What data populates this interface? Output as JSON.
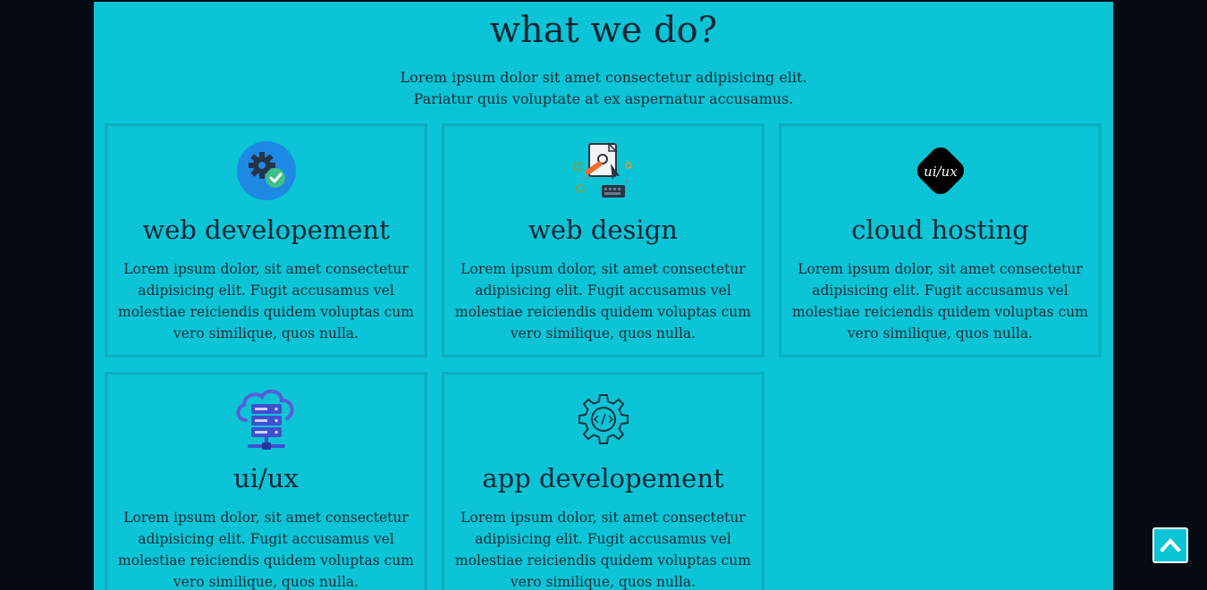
{
  "section": {
    "title": "what we do?",
    "subtitle_line1": "Lorem ipsum dolor sit amet consectetur adipisicing elit.",
    "subtitle_line2": "Pariatur quis voluptate at ex aspernatur accusamus."
  },
  "cards": [
    {
      "title": "web developement",
      "text": "Lorem ipsum dolor, sit amet consectetur adipisicing elit. Fugit accusamus vel molestiae reiciendis quidem voluptas cum vero similique, quos nulla.",
      "icon": "gear-check-icon"
    },
    {
      "title": "web design",
      "text": "Lorem ipsum dolor, sit amet consectetur adipisicing elit. Fugit accusamus vel molestiae reiciendis quidem voluptas cum vero similique, quos nulla.",
      "icon": "design-tools-icon"
    },
    {
      "title": "cloud hosting",
      "text": "Lorem ipsum dolor, sit amet consectetur adipisicing elit. Fugit accusamus vel molestiae reiciendis quidem voluptas cum vero similique, quos nulla.",
      "icon": "uiux-badge-icon",
      "icon_text": "ui/ux"
    },
    {
      "title": "ui/ux",
      "text": "Lorem ipsum dolor, sit amet consectetur adipisicing elit. Fugit accusamus vel molestiae reiciendis quidem voluptas cum vero similique, quos nulla.",
      "icon": "cloud-server-icon"
    },
    {
      "title": "app developement",
      "text": "Lorem ipsum dolor, sit amet consectetur adipisicing elit. Fugit accusamus vel molestiae reiciendis quidem voluptas cum vero similique, quos nulla.",
      "icon": "code-gear-icon"
    }
  ],
  "scroll_top": {
    "icon": "chevron-up-icon"
  },
  "colors": {
    "page_background": "#050a14",
    "section_background": "#0bc5d6",
    "card_border": "#09b0bf",
    "text": "#132535",
    "accent_blue": "#1e88e5",
    "accent_purple": "#5b5bd6"
  }
}
